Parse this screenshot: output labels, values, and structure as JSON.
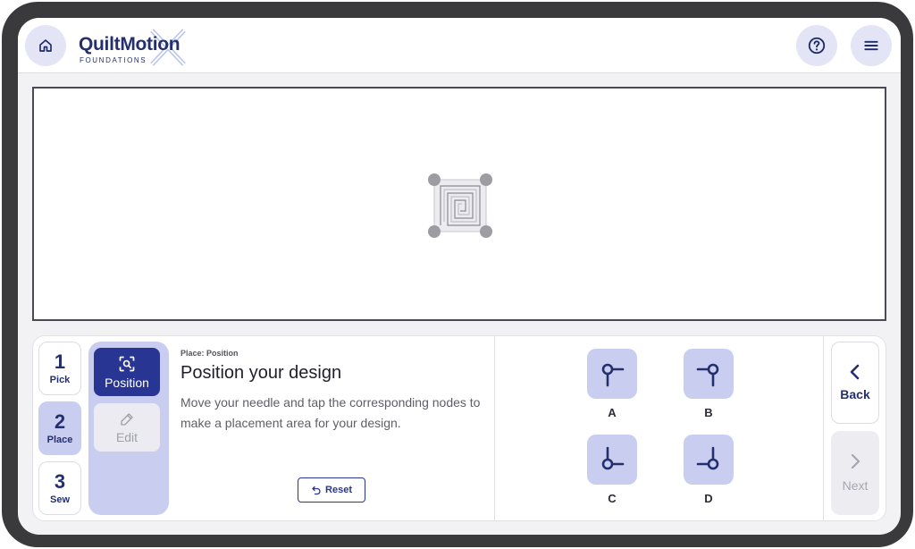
{
  "header": {
    "logo_main": "QuiltMotion",
    "logo_sub": "FOUNDATIONS",
    "home_icon": "home-icon",
    "help_icon": "help-icon",
    "menu_icon": "menu-icon"
  },
  "steps": [
    {
      "num": "1",
      "label": "Pick",
      "active": false
    },
    {
      "num": "2",
      "label": "Place",
      "active": true
    },
    {
      "num": "3",
      "label": "Sew",
      "active": false
    }
  ],
  "substeps": {
    "position": {
      "label": "Position",
      "icon": "focus-icon",
      "active": true
    },
    "edit": {
      "label": "Edit",
      "icon": "pencil-icon",
      "enabled": false
    }
  },
  "instructions": {
    "eyebrow": "Place: Position",
    "title": "Position your design",
    "description": "Move your needle and tap the corresponding nodes to make a placement area for your design.",
    "reset_label": "Reset"
  },
  "nodes": [
    {
      "label": "A",
      "corner": "top-left"
    },
    {
      "label": "B",
      "corner": "top-right"
    },
    {
      "label": "C",
      "corner": "bottom-left"
    },
    {
      "label": "D",
      "corner": "bottom-right"
    }
  ],
  "nav": {
    "back_label": "Back",
    "next_label": "Next",
    "next_enabled": false
  },
  "colors": {
    "brand": "#24306e",
    "accent": "#283593",
    "accent_light": "#c9cdf0",
    "frame": "#3a3a3c"
  }
}
